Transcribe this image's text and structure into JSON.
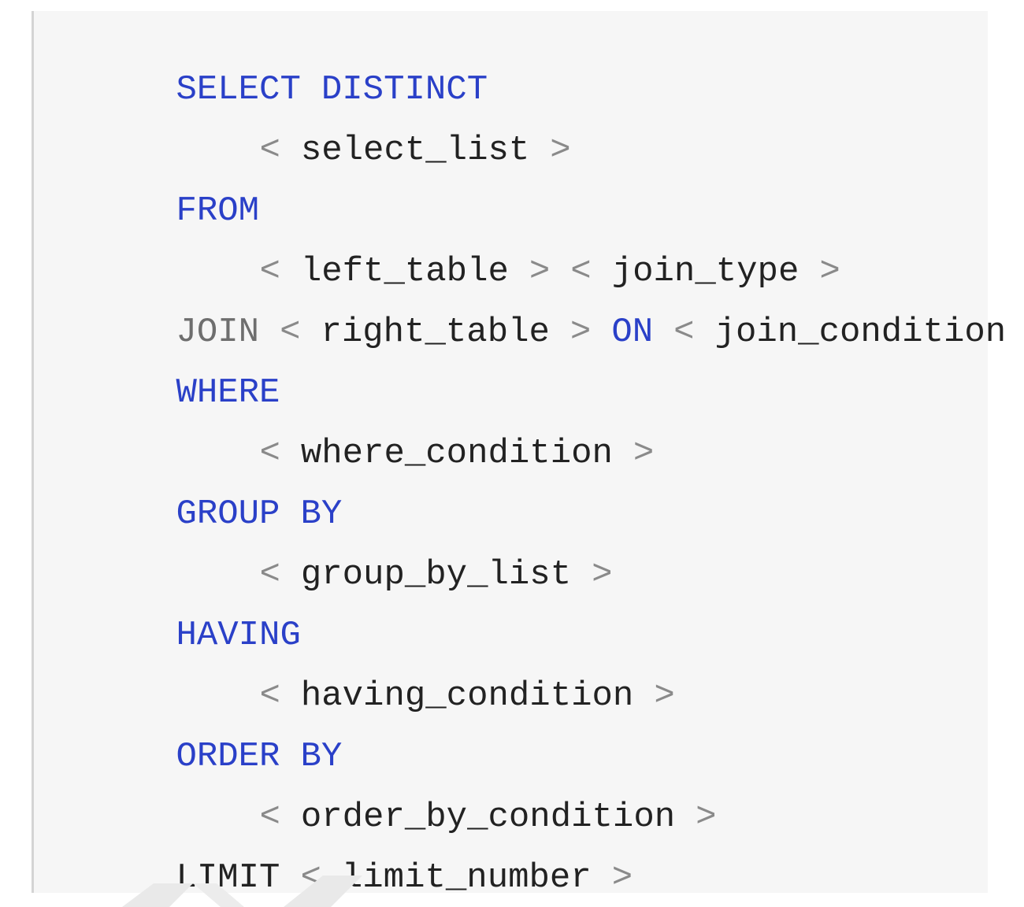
{
  "code": {
    "line1": {
      "kw1": "SELECT",
      "kw2": "DISTINCT"
    },
    "line2": {
      "open": "<",
      "ident": "select_list",
      "close": ">"
    },
    "line3": {
      "kw": "FROM"
    },
    "line4": {
      "open1": "<",
      "ident1": "left_table",
      "close1": ">",
      "open2": "<",
      "ident2": "join_type",
      "close2": ">"
    },
    "line5": {
      "kw1": "JOIN",
      "open1": "<",
      "ident1": "right_table",
      "close1": ">",
      "kw2": "ON",
      "open2": "<",
      "ident2": "join_condition",
      "close2": ">"
    },
    "line6": {
      "kw": "WHERE"
    },
    "line7": {
      "open": "<",
      "ident": "where_condition",
      "close": ">"
    },
    "line8": {
      "kw1": "GROUP",
      "kw2": "BY"
    },
    "line9": {
      "open": "<",
      "ident": "group_by_list",
      "close": ">"
    },
    "line10": {
      "kw": "HAVING"
    },
    "line11": {
      "open": "<",
      "ident": "having_condition",
      "close": ">"
    },
    "line12": {
      "kw1": "ORDER",
      "kw2": "BY"
    },
    "line13": {
      "open": "<",
      "ident": "order_by_condition",
      "close": ">"
    },
    "line14": {
      "kw": "LIMIT",
      "open": "<",
      "ident": "limit_number",
      "close": ">"
    }
  },
  "colors": {
    "keyword": "#2a40c8",
    "keyword_gray": "#6e6e6e",
    "identifier": "#222222",
    "bracket": "#8a8a8a",
    "background": "#f6f6f6"
  }
}
